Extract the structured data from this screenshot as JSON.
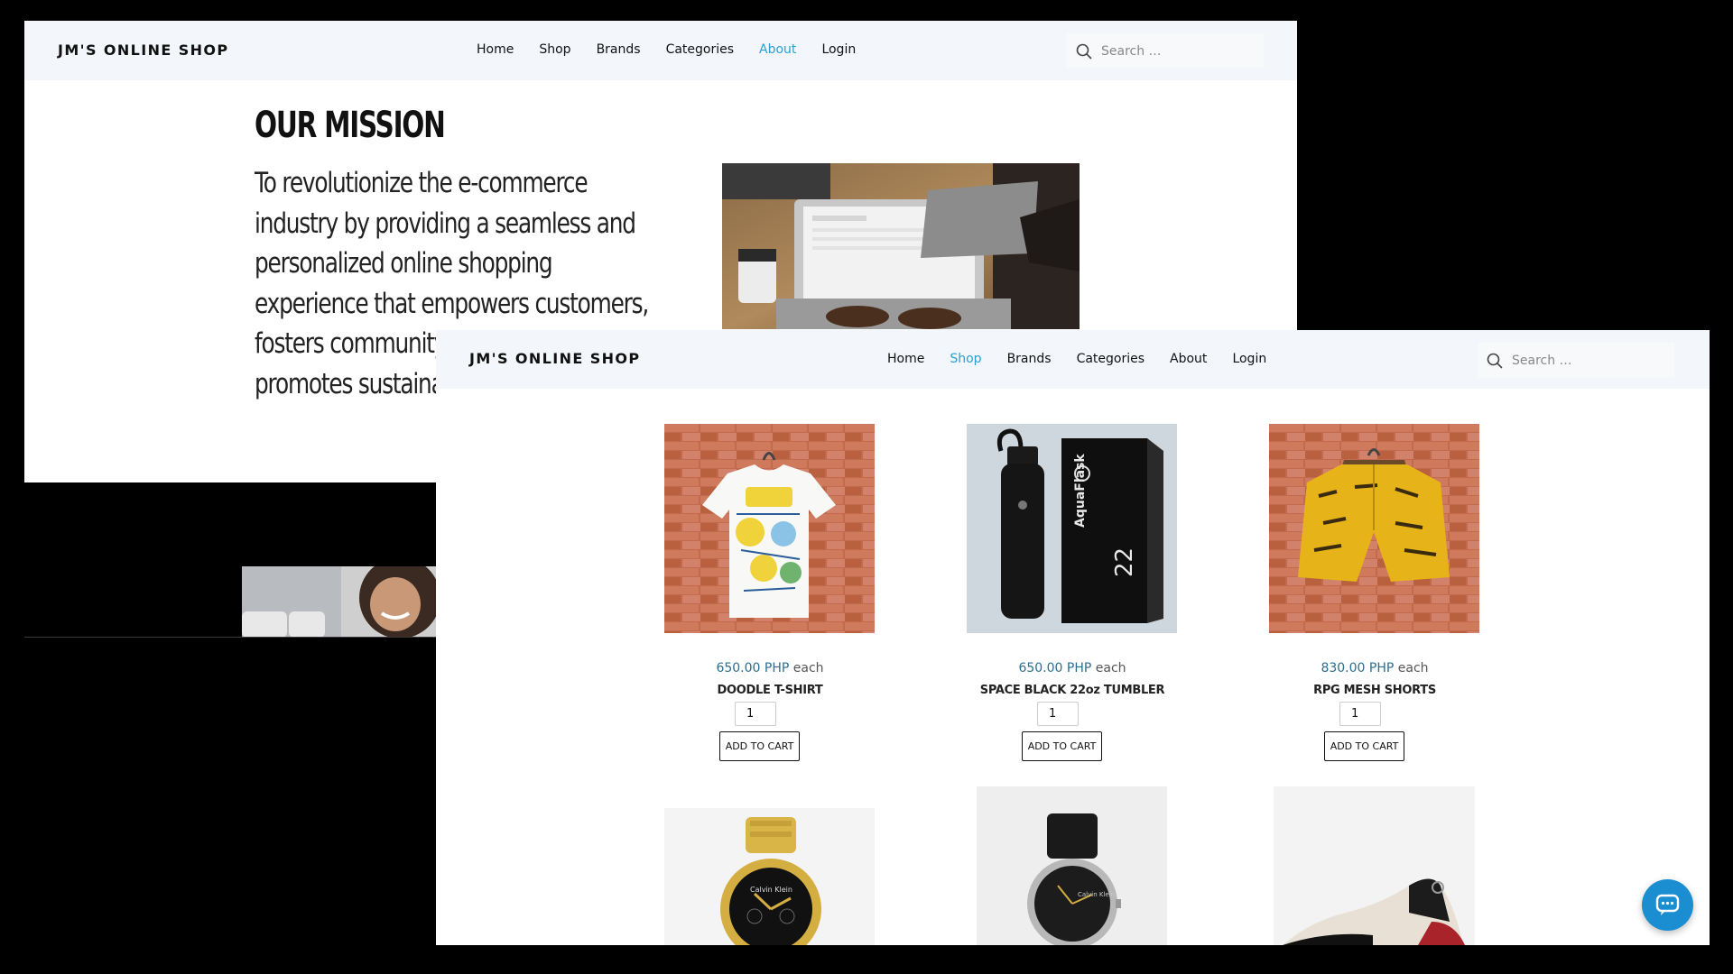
{
  "back_page": {
    "brand": "JM'S ONLINE SHOP",
    "nav": [
      {
        "label": "Home",
        "active": false
      },
      {
        "label": "Shop",
        "active": false
      },
      {
        "label": "Brands",
        "active": false
      },
      {
        "label": "Categories",
        "active": false
      },
      {
        "label": "About",
        "active": true
      },
      {
        "label": "Login",
        "active": false
      }
    ],
    "search_placeholder": "Search …",
    "mission_title": "OUR MISSION",
    "mission_text": "To revolutionize the e-commerce industry by providing a seamless and personalized online shopping experience that empowers customers, fosters community engagement, and promotes sustainable consump"
  },
  "front_page": {
    "brand": "JM'S ONLINE SHOP",
    "nav": [
      {
        "label": "Home",
        "active": false
      },
      {
        "label": "Shop",
        "active": true
      },
      {
        "label": "Brands",
        "active": false
      },
      {
        "label": "Categories",
        "active": false
      },
      {
        "label": "About",
        "active": false
      },
      {
        "label": "Login",
        "active": false
      }
    ],
    "search_placeholder": "Search …",
    "products": [
      {
        "price": "650.00 PHP",
        "unit": "each",
        "name": "DOODLE T-SHIRT",
        "qty": "1",
        "button": "ADD TO CART"
      },
      {
        "price": "650.00 PHP",
        "unit": "each",
        "name": "SPACE BLACK 22oz TUMBLER",
        "qty": "1",
        "button": "ADD TO CART"
      },
      {
        "price": "830.00 PHP",
        "unit": "each",
        "name": "RPG MESH SHORTS",
        "qty": "1",
        "button": "ADD TO CART"
      }
    ],
    "tumbler_brand": "AquaFlask",
    "tumbler_size": "22",
    "watch_brand": "Calvin Klein"
  },
  "icons": {
    "search": "search-icon",
    "chat": "chat-icon"
  },
  "colors": {
    "active_nav": "#2a9fd6",
    "price": "#2c6e8f",
    "navbar_bg": "#f3f7fb",
    "chat_button": "#1a8ed0"
  }
}
